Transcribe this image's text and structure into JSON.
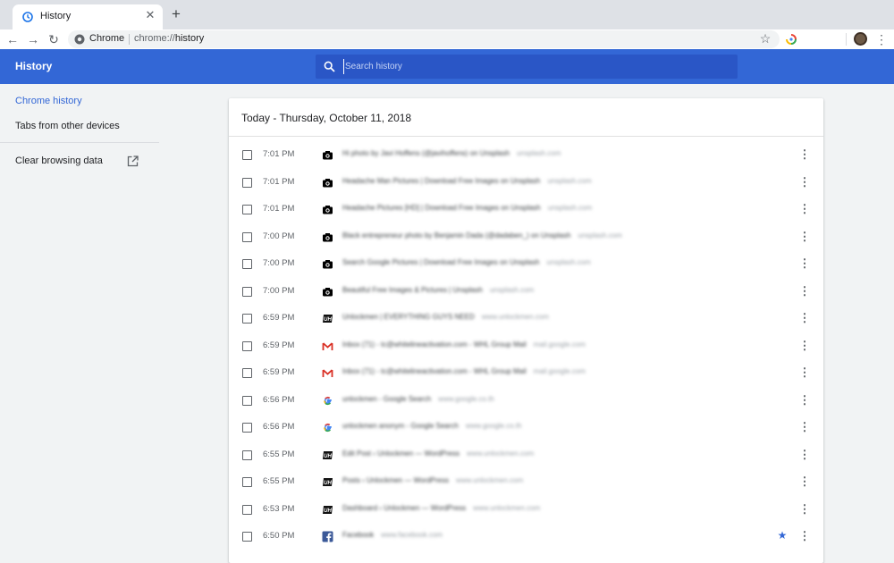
{
  "tab": {
    "title": "History",
    "icon": "history-icon",
    "close_icon": "close-icon"
  },
  "new_tab_icon": "plus-icon",
  "toolbar": {
    "back_icon": "arrow-back-icon",
    "forward_icon": "arrow-forward-icon",
    "reload_icon": "reload-icon",
    "site_label": "Chrome",
    "url_scheme": "chrome://",
    "url_host": "history",
    "bookmark_icon": "star-outline-icon",
    "menu_icon": "more-vert-icon"
  },
  "header": {
    "title": "History",
    "search_placeholder": "Search history",
    "accent_color": "#3367d6"
  },
  "sidebar": {
    "items": [
      {
        "label": "Chrome history",
        "active": true
      },
      {
        "label": "Tabs from other devices",
        "active": false
      }
    ],
    "clear_label": "Clear browsing data"
  },
  "main": {
    "date_heading": "Today - Thursday, October 11, 2018",
    "rows": [
      {
        "time": "7:01 PM",
        "icon": "camera-icon",
        "title": "Hi photo by Javi Hoffens (@javihoffens) on Unsplash",
        "domain": "unsplash.com",
        "starred": false
      },
      {
        "time": "7:01 PM",
        "icon": "camera-icon",
        "title": "Headache Man Pictures | Download Free Images on Unsplash",
        "domain": "unsplash.com",
        "starred": false
      },
      {
        "time": "7:01 PM",
        "icon": "camera-icon",
        "title": "Headache Pictures [HD] | Download Free Images on Unsplash",
        "domain": "unsplash.com",
        "starred": false
      },
      {
        "time": "7:00 PM",
        "icon": "camera-icon",
        "title": "Black entrepreneur photo by Benjamin Dada (@dadaben_) on Unsplash",
        "domain": "unsplash.com",
        "starred": false
      },
      {
        "time": "7:00 PM",
        "icon": "camera-icon",
        "title": "Search Google Pictures | Download Free Images on Unsplash",
        "domain": "unsplash.com",
        "starred": false
      },
      {
        "time": "7:00 PM",
        "icon": "camera-icon",
        "title": "Beautiful Free Images & Pictures | Unsplash",
        "domain": "unsplash.com",
        "starred": false
      },
      {
        "time": "6:59 PM",
        "icon": "uh-logo-icon",
        "title": "Unlockmen | EVERYTHING GUYS NEED",
        "domain": "www.unlockmen.com",
        "starred": false
      },
      {
        "time": "6:59 PM",
        "icon": "gmail-icon",
        "title": "Inbox (71) - tc@whitelineactivation.com - WHL Group Mail",
        "domain": "mail.google.com",
        "starred": false
      },
      {
        "time": "6:59 PM",
        "icon": "gmail-icon",
        "title": "Inbox (71) - tc@whitelineactivation.com - WHL Group Mail",
        "domain": "mail.google.com",
        "starred": false
      },
      {
        "time": "6:56 PM",
        "icon": "google-icon",
        "title": "unlockmen - Google Search",
        "domain": "www.google.co.th",
        "starred": false
      },
      {
        "time": "6:56 PM",
        "icon": "google-icon",
        "title": "unlockmen anonym - Google Search",
        "domain": "www.google.co.th",
        "starred": false
      },
      {
        "time": "6:55 PM",
        "icon": "uh-logo-icon",
        "title": "Edit Post ‹ Unlockmen — WordPress",
        "domain": "www.unlockmen.com",
        "starred": false
      },
      {
        "time": "6:55 PM",
        "icon": "uh-logo-icon",
        "title": "Posts ‹ Unlockmen — WordPress",
        "domain": "www.unlockmen.com",
        "starred": false
      },
      {
        "time": "6:53 PM",
        "icon": "uh-logo-icon",
        "title": "Dashboard ‹ Unlockmen — WordPress",
        "domain": "www.unlockmen.com",
        "starred": false
      },
      {
        "time": "6:50 PM",
        "icon": "facebook-icon",
        "title": "Facebook",
        "domain": "www.facebook.com",
        "starred": true
      }
    ]
  }
}
